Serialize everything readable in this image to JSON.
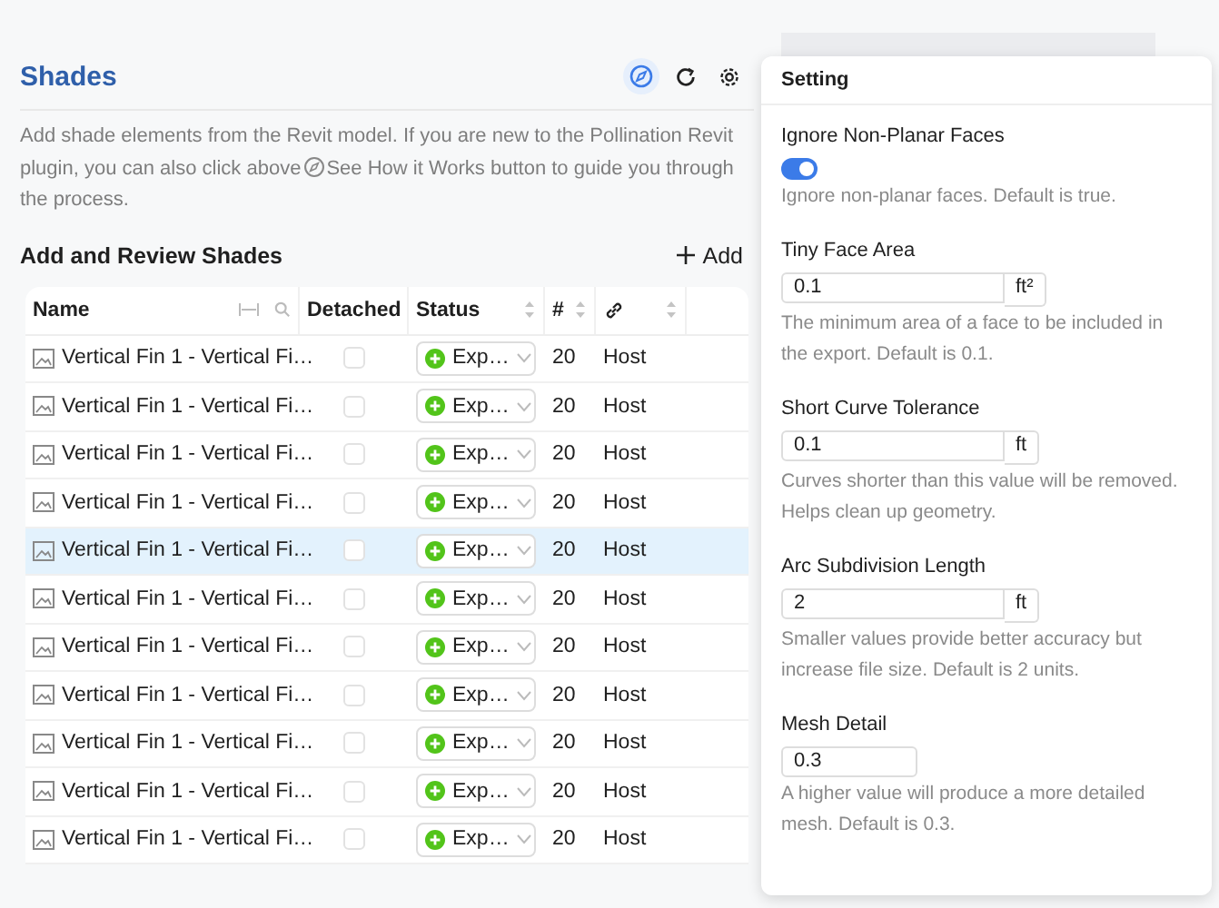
{
  "panel": {
    "title": "Shades",
    "description_before": "Add shade elements from the Revit model. If you are new to the Pollination Revit plugin, you can also click above",
    "description_after": "See How it Works button to guide you through the process."
  },
  "section": {
    "title": "Add and Review Shades",
    "add_label": "Add"
  },
  "table": {
    "columns": [
      "Name",
      "Detached",
      "Status",
      "#"
    ],
    "rows": [
      {
        "name": "Vertical Fin 1 - Vertical Fi…",
        "detached": false,
        "status": "Exp…",
        "count": "20",
        "link": "Host",
        "selected": false
      },
      {
        "name": "Vertical Fin 1 - Vertical Fi…",
        "detached": false,
        "status": "Exp…",
        "count": "20",
        "link": "Host",
        "selected": false
      },
      {
        "name": "Vertical Fin 1 - Vertical Fi…",
        "detached": false,
        "status": "Exp…",
        "count": "20",
        "link": "Host",
        "selected": false
      },
      {
        "name": "Vertical Fin 1 - Vertical Fi…",
        "detached": false,
        "status": "Exp…",
        "count": "20",
        "link": "Host",
        "selected": false
      },
      {
        "name": "Vertical Fin 1 - Vertical Fi…",
        "detached": false,
        "status": "Exp…",
        "count": "20",
        "link": "Host",
        "selected": true
      },
      {
        "name": "Vertical Fin 1 - Vertical Fi…",
        "detached": false,
        "status": "Exp…",
        "count": "20",
        "link": "Host",
        "selected": false
      },
      {
        "name": "Vertical Fin 1 - Vertical Fi…",
        "detached": false,
        "status": "Exp…",
        "count": "20",
        "link": "Host",
        "selected": false
      },
      {
        "name": "Vertical Fin 1 - Vertical Fi…",
        "detached": false,
        "status": "Exp…",
        "count": "20",
        "link": "Host",
        "selected": false
      },
      {
        "name": "Vertical Fin 1 - Vertical Fi…",
        "detached": false,
        "status": "Exp…",
        "count": "20",
        "link": "Host",
        "selected": false
      },
      {
        "name": "Vertical Fin 1 - Vertical Fi…",
        "detached": false,
        "status": "Exp…",
        "count": "20",
        "link": "Host",
        "selected": false
      },
      {
        "name": "Vertical Fin 1 - Vertical Fi…",
        "detached": false,
        "status": "Exp…",
        "count": "20",
        "link": "Host",
        "selected": false
      }
    ]
  },
  "settings": {
    "title": "Setting",
    "items": [
      {
        "kind": "toggle",
        "label": "Ignore Non-Planar Faces",
        "on": true,
        "help": "Ignore non-planar faces. Default is true."
      },
      {
        "kind": "number",
        "label": "Tiny Face Area",
        "value": "0.1",
        "unit": "ft²",
        "help": "The minimum area of a face to be included in the export. Default is 0.1."
      },
      {
        "kind": "number",
        "label": "Short Curve Tolerance",
        "value": "0.1",
        "unit": "ft",
        "help": "Curves shorter than this value will be removed. Helps clean up geometry."
      },
      {
        "kind": "number",
        "label": "Arc Subdivision Length",
        "value": "2",
        "unit": "ft",
        "help": "Smaller values provide better accuracy but increase file size. Default is 2 units."
      },
      {
        "kind": "number",
        "label": "Mesh Detail",
        "value": "0.3",
        "help": "A higher value will produce a more detailed mesh. Default is 0.3."
      }
    ]
  }
}
